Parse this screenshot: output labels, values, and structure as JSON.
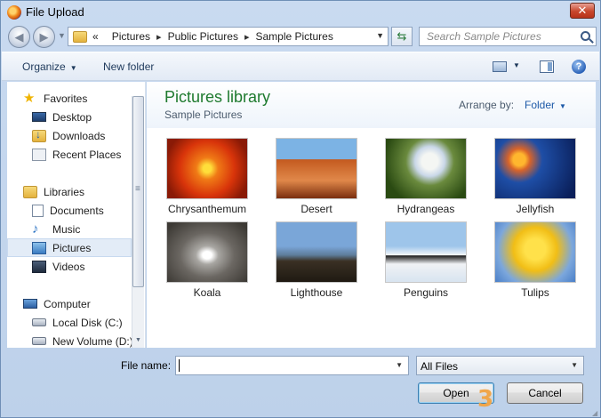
{
  "window": {
    "title": "File Upload",
    "close_glyph": "✕"
  },
  "address": {
    "breadcrumb": [
      "«",
      "Pictures",
      "Public Pictures",
      "Sample Pictures"
    ],
    "separator": "▸"
  },
  "search": {
    "placeholder": "Search Sample Pictures"
  },
  "toolbar": {
    "organize_label": "Organize",
    "new_folder_label": "New folder",
    "help_glyph": "?"
  },
  "sidebar": {
    "items": [
      {
        "label": "Favorites",
        "icon": "star-icon"
      },
      {
        "label": "Desktop",
        "icon": "desktop-icon"
      },
      {
        "label": "Downloads",
        "icon": "downloads-folder-icon"
      },
      {
        "label": "Recent Places",
        "icon": "recent-places-icon"
      },
      {
        "label": "Libraries",
        "icon": "libraries-icon"
      },
      {
        "label": "Documents",
        "icon": "documents-icon"
      },
      {
        "label": "Music",
        "icon": "music-icon"
      },
      {
        "label": "Pictures",
        "icon": "pictures-icon",
        "selected": true
      },
      {
        "label": "Videos",
        "icon": "videos-icon"
      },
      {
        "label": "Computer",
        "icon": "computer-icon"
      },
      {
        "label": "Local Disk (C:)",
        "icon": "disk-icon"
      },
      {
        "label": "New Volume (D:)",
        "icon": "disk-icon"
      }
    ]
  },
  "library": {
    "title": "Pictures library",
    "subtitle": "Sample Pictures",
    "arrange_label": "Arrange by:",
    "arrange_value": "Folder"
  },
  "files": [
    {
      "name": "Chrysanthemum"
    },
    {
      "name": "Desert"
    },
    {
      "name": "Hydrangeas"
    },
    {
      "name": "Jellyfish"
    },
    {
      "name": "Koala"
    },
    {
      "name": "Lighthouse"
    },
    {
      "name": "Penguins"
    },
    {
      "name": "Tulips"
    }
  ],
  "footer": {
    "file_name_label": "File name:",
    "file_name_value": "",
    "filter_value": "All Files",
    "open_label": "Open",
    "cancel_label": "Cancel"
  },
  "annotation": {
    "marker": "3",
    "color": "#f0a64a"
  }
}
